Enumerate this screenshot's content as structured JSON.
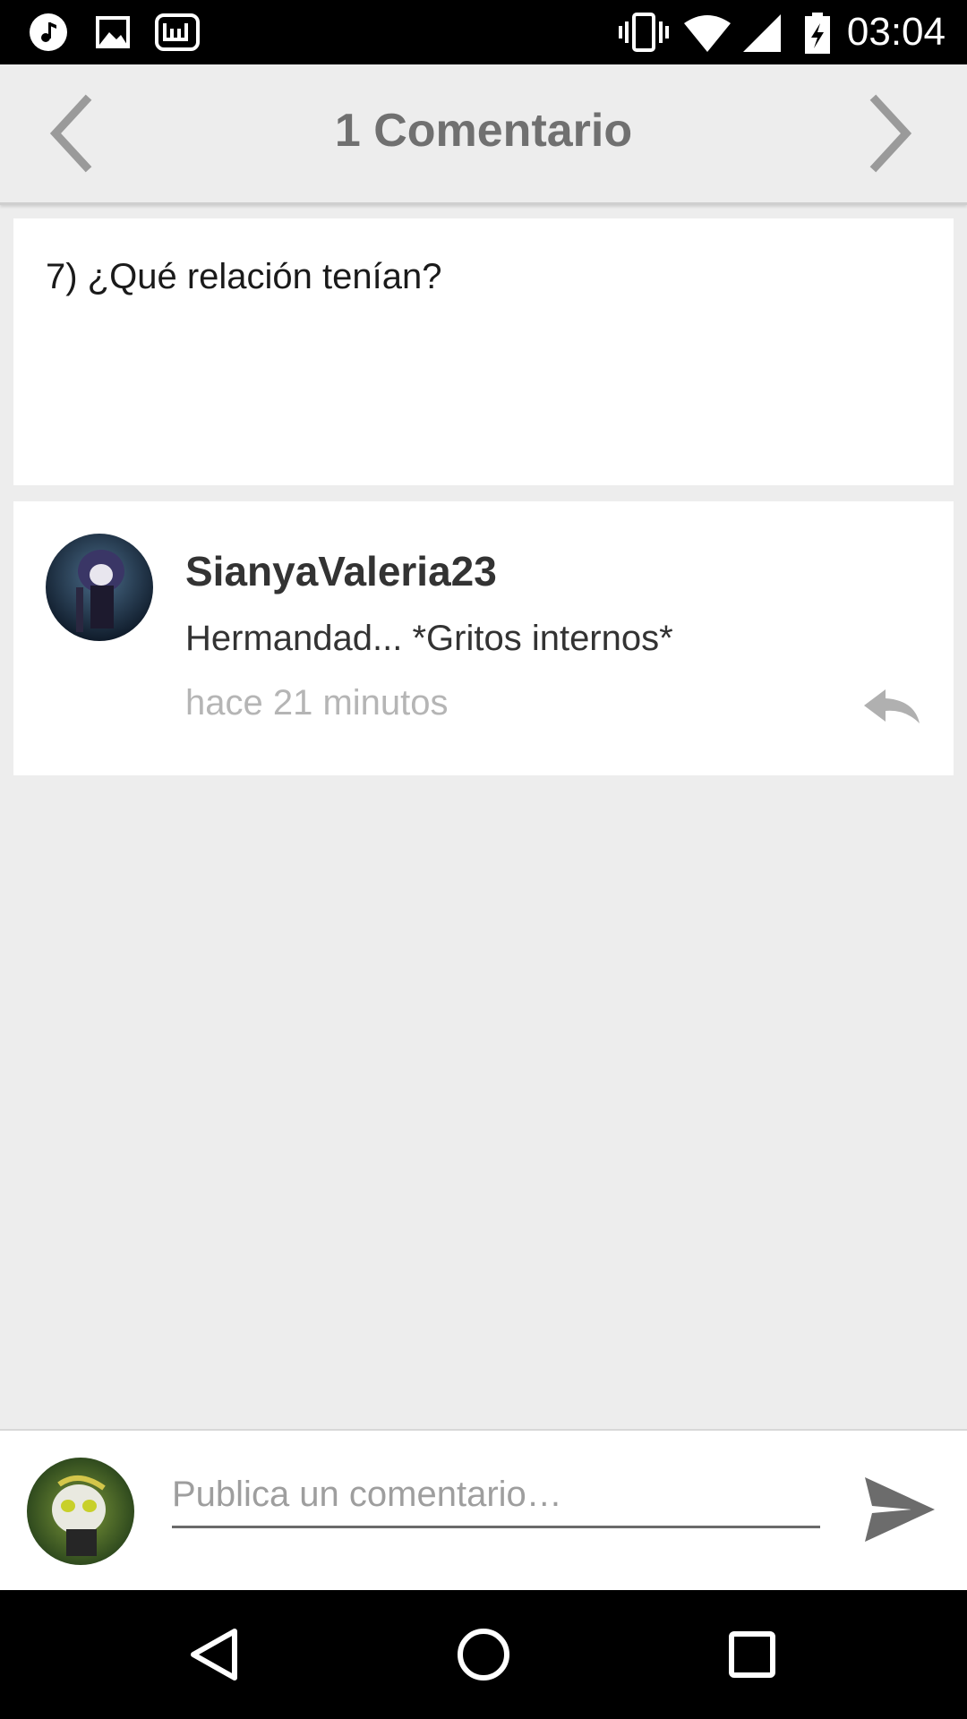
{
  "status_bar": {
    "time": "03:04",
    "icons": [
      "music-note-icon",
      "image-icon",
      "wattpad-icon",
      "vibrate-icon",
      "wifi-icon",
      "signal-icon",
      "battery-charging-icon"
    ]
  },
  "header": {
    "title": "1 Comentario",
    "back_icon": "chevron-left-icon",
    "forward_icon": "chevron-right-icon"
  },
  "post": {
    "text": "7) ¿Qué relación tenían?"
  },
  "comment": {
    "author": "SianyaValeria23",
    "body": "Hermandad... *Gritos internos*",
    "time": "hace 21 minutos",
    "reply_icon": "reply-icon"
  },
  "composer": {
    "placeholder": "Publica un comentario…",
    "send_icon": "send-icon"
  },
  "nav_bar": {
    "icons": [
      "back-triangle-icon",
      "home-circle-icon",
      "recents-square-icon"
    ]
  }
}
